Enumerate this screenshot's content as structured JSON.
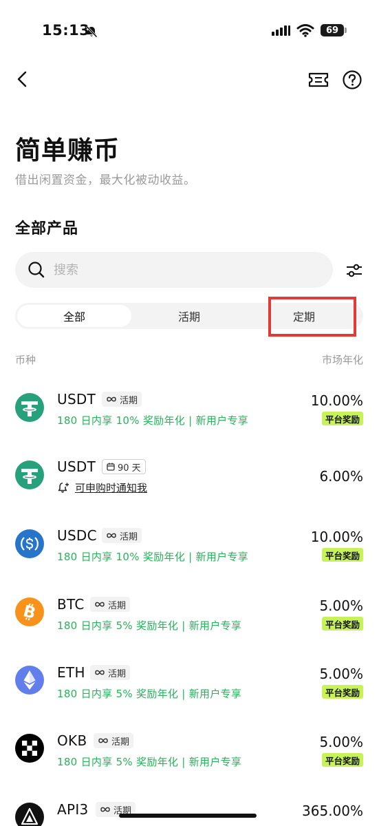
{
  "status_bar": {
    "time": "15:13",
    "battery": "69"
  },
  "header": {
    "title": "简单赚币",
    "subtitle": "借出闲置资金，最大化被动收益。"
  },
  "section_title": "全部产品",
  "search": {
    "placeholder": "搜索"
  },
  "tabs": [
    {
      "label": "全部",
      "active": true
    },
    {
      "label": "活期",
      "active": false
    },
    {
      "label": "定期",
      "active": false
    }
  ],
  "columns": {
    "coin": "币种",
    "apr": "市场年化"
  },
  "products": [
    {
      "symbol": "USDT",
      "coin_icon": "tether-icon",
      "tag_icon": "infinity-icon",
      "tag": "活期",
      "desc": "180 日内享 10% 奖励年化 | 新用户专享",
      "rate": "10.00%",
      "badge": "平台奖励",
      "color": "#26a17b"
    },
    {
      "symbol": "USDT",
      "coin_icon": "tether-icon",
      "tag_icon": "calendar-icon",
      "tag": "90 天",
      "notify": "可申购时通知我",
      "rate": "6.00%",
      "color": "#26a17b"
    },
    {
      "symbol": "USDC",
      "coin_icon": "usdc-icon",
      "tag_icon": "infinity-icon",
      "tag": "活期",
      "desc": "180 日内享 10% 奖励年化 | 新用户专享",
      "rate": "10.00%",
      "badge": "平台奖励",
      "color": "#2775ca"
    },
    {
      "symbol": "BTC",
      "coin_icon": "bitcoin-icon",
      "tag_icon": "infinity-icon",
      "tag": "活期",
      "desc": "180 日内享 5% 奖励年化 | 新用户专享",
      "rate": "5.00%",
      "badge": "平台奖励",
      "color": "#f7931a"
    },
    {
      "symbol": "ETH",
      "coin_icon": "ethereum-icon",
      "tag_icon": "infinity-icon",
      "tag": "活期",
      "desc": "180 日内享 5% 奖励年化 | 新用户专享",
      "rate": "5.00%",
      "badge": "平台奖励",
      "color": "#627eea"
    },
    {
      "symbol": "OKB",
      "coin_icon": "okb-icon",
      "tag_icon": "infinity-icon",
      "tag": "活期",
      "desc": "180 日内享 5% 奖励年化 | 新用户专享",
      "rate": "5.00%",
      "badge": "平台奖励",
      "color": "#000000"
    },
    {
      "symbol": "API3",
      "coin_icon": "api3-icon",
      "tag_icon": "infinity-icon",
      "tag": "活期",
      "rate": "365.00%",
      "color": "#111111"
    }
  ],
  "colors": {
    "accent_green": "#25b35a",
    "badge_bg": "#c7f25a",
    "highlight": "#e23b36"
  }
}
